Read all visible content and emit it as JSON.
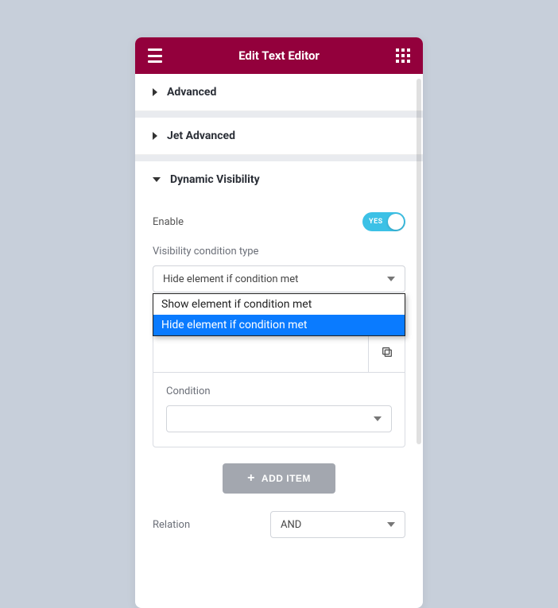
{
  "header": {
    "title": "Edit Text Editor"
  },
  "sections": {
    "advanced": {
      "title": "Advanced"
    },
    "jet_advanced": {
      "title": "Jet Advanced"
    },
    "dynamic_visibility": {
      "title": "Dynamic Visibility"
    }
  },
  "dv": {
    "enable_label": "Enable",
    "toggle_text": "YES",
    "vctype_label": "Visibility condition type",
    "vctype_selected": "Hide element if condition met",
    "vctype_options": {
      "show": "Show element if condition met",
      "hide": "Hide element if condition met"
    },
    "condition_label": "Condition",
    "add_item_label": "ADD ITEM",
    "relation_label": "Relation",
    "relation_selected": "AND"
  }
}
